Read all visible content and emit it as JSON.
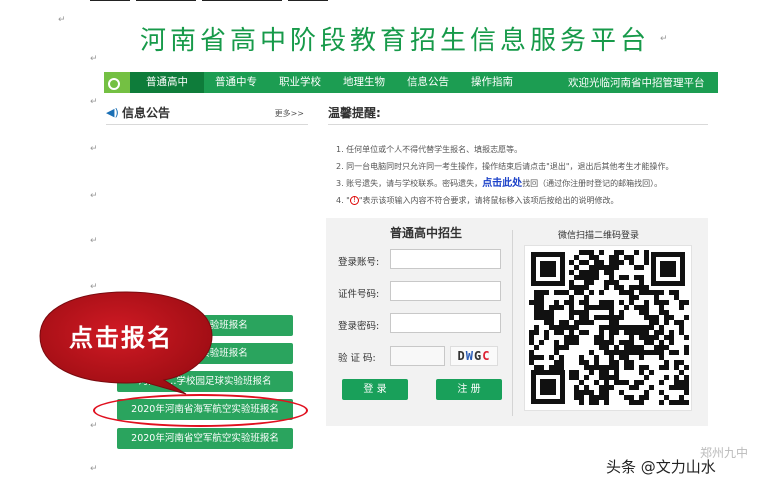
{
  "site_title": "河南省高中阶段教育招生信息服务平台",
  "nav": {
    "items": [
      "普通高中",
      "普通中专",
      "职业学校",
      "地理生物",
      "信息公告",
      "操作指南"
    ],
    "welcome": "欢迎光临河南省中招管理平台"
  },
  "news": {
    "title": "信息公告",
    "more": "更多>>"
  },
  "tips": {
    "title": "温馨提醒:",
    "items": [
      "1. 任何单位或个人不得代替学生报名、填报志愿等。",
      "2. 同一台电脑同时只允许同一考生操作，操作结束后请点击\"退出\"，退出后其他考生才能操作。",
      "3. 账号遗失，请与学校联系。密码遗失，",
      "点击此处",
      "找回（通过你注册时登记的邮箱找回）。",
      "4. \"",
      "\"表示该项输入内容不符合要求，请将鼠标移入该项后按给出的说明修改。"
    ]
  },
  "login": {
    "title": "普通高中招生",
    "account_label": "登录账号:",
    "id_label": "证件号码:",
    "password_label": "登录密码:",
    "captcha_label": "验 证 码:",
    "captcha_chars": [
      "D",
      "W",
      "G",
      "C"
    ],
    "login_button": "登 录",
    "register_button": "注 册"
  },
  "qr": {
    "title": "微信扫描二维码登录"
  },
  "side_buttons": [
    "河南省…实验班报名",
    "河南省…实验班报名",
    "河南省…学校园足球实验班报名",
    "2020年河南省海军航空实验班报名",
    "2020年河南省空军航空实验班报名"
  ],
  "annotation": {
    "bubble_text": "点击报名",
    "bubble_color": "#c8141e"
  },
  "watermark": {
    "text": "头条 @文力山水",
    "faint": "郑州九中"
  },
  "colors": {
    "brand_green": "#179a4a",
    "nav_green": "#1c9d52",
    "button_green": "#19a05a",
    "link_blue": "#1a40c8",
    "alert_red": "#e0101f"
  }
}
